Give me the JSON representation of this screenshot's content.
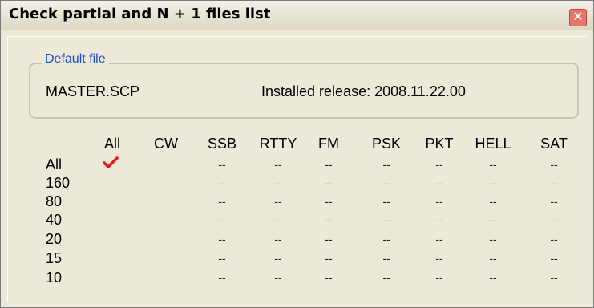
{
  "window": {
    "title": "Check partial and N + 1 files list",
    "close_symbol": "✕"
  },
  "default_file": {
    "legend": "Default file",
    "filename": "MASTER.SCP",
    "installed_release": "Installed release: 2008.11.22.00"
  },
  "grid": {
    "columns": [
      "All",
      "CW",
      "SSB",
      "RTTY",
      "FM",
      "PSK",
      "PKT",
      "HELL",
      "SAT"
    ],
    "rows": [
      "All",
      "160",
      "80",
      "40",
      "20",
      "15",
      "10"
    ],
    "dash": "--",
    "checked": {
      "row": "All",
      "column": "All",
      "icon": "checkmark-icon",
      "color": "#e81616"
    }
  },
  "colors": {
    "legend": "#1f4bd1",
    "close_button": "#e4786c",
    "dialog_background": "#ece9d8"
  }
}
